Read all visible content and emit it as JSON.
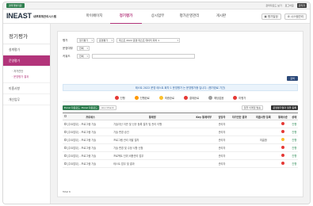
{
  "topbar": {
    "left_label": "경력개발지원",
    "right_items": [
      "관리자모드 보기",
      "로그아웃",
      "관리자"
    ]
  },
  "header": {
    "logo": "INEAST",
    "logo_sub": "내부회계관리시스템",
    "nav": [
      "마이페이지",
      "정기평가",
      "상시업무",
      "평가운영관리",
      "게시판"
    ],
    "active_nav": 1,
    "buttons": [
      "평가일정",
      "시스템관리"
    ]
  },
  "sidebar": {
    "title": "정기평가",
    "items": [
      {
        "label": "설계평가",
        "active": false
      },
      {
        "label": "운영평가",
        "active": true
      }
    ],
    "subitems": [
      {
        "label": "· 자가진단",
        "active": false
      },
      {
        "label": "· 운영평가 결과",
        "active": true
      }
    ],
    "items_after": [
      "미흡사항",
      "개선업무"
    ]
  },
  "filters": {
    "row1_label": "평가",
    "row1_values": [
      "정기평가",
      "운영평가",
      "테스트 2022 운영 테스트 데이터 회차 1"
    ],
    "row2_label": "운영여부",
    "row2_value": "전체",
    "row3_label": "키워드",
    "row3_value": "전체",
    "search_label": "검색"
  },
  "notice": "테스트 2022 운영 테스트 회차 1 운영평가 는 운영평가중 입니다. (평가완료 기간)",
  "legend": [
    {
      "label": "진행",
      "color": "#e53935"
    },
    {
      "label": "진행완료",
      "color": "#ff9800"
    },
    {
      "label": "최종완료",
      "color": "#fbc02d"
    },
    {
      "label": "결재완료",
      "color": "#e53935"
    },
    {
      "label": "해당없음",
      "color": "#9e9e9e"
    },
    {
      "label": "미평가",
      "color": "#e53935"
    }
  ],
  "actions": {
    "left": [
      "Excel 다운로드",
      "Excel 다운로드",
      "ALL Check"
    ],
    "right": [
      "일괄 이메일 발송",
      "운영평가결과 일괄 등록"
    ]
  },
  "table": {
    "headers": [
      "",
      "프로세스",
      "통제명",
      "Key 통제여부",
      "담당자",
      "자가진단 결과",
      "미흡사항 등록",
      "통제수준",
      "상태"
    ],
    "rows": [
      {
        "proc": "[주요업무] - 프로그램 기술",
        "ctrl": "기술자산 이관 및 신규 등록 절차 및 관리 이행",
        "key": "",
        "owner": "관리자",
        "self": "",
        "issue": "",
        "level_color": "#e53935",
        "status": "진행"
      },
      {
        "proc": "[주요업무] - 프로그램 기술",
        "ctrl": "기술 변경 승인",
        "key": "",
        "owner": "관리자",
        "self": "",
        "issue": "",
        "level_color": "#e53935",
        "status": "진행"
      },
      {
        "proc": "[주요업무] - 프로그램 기술",
        "ctrl": "프로그램 관리 개발 절차",
        "key": "",
        "owner": "관리자",
        "self": "",
        "issue": "미흡함",
        "level_color": "#fbc02d",
        "status": "진행"
      },
      {
        "proc": "[주요업무] - 프로그램 기술",
        "ctrl": "기술 변경 및 수정 사항 신청",
        "key": "",
        "owner": "관리자",
        "self": "",
        "issue": "",
        "level_color": "#e53935",
        "status": "진행"
      },
      {
        "proc": "[주요업무] - 프로그램 기술",
        "ctrl": "프로젝트 단위 비용관리 업무",
        "key": "",
        "owner": "관리자",
        "self": "",
        "issue": "",
        "level_color": "#e53935",
        "status": "진행"
      },
      {
        "proc": "[주요업무] - 프로그램 기술",
        "ctrl": "테스트 업무 및 결과",
        "key": "",
        "owner": "관리자",
        "self": "",
        "issue": "",
        "level_color": "#e53935",
        "status": "진행"
      }
    ]
  },
  "total": "Total 6"
}
